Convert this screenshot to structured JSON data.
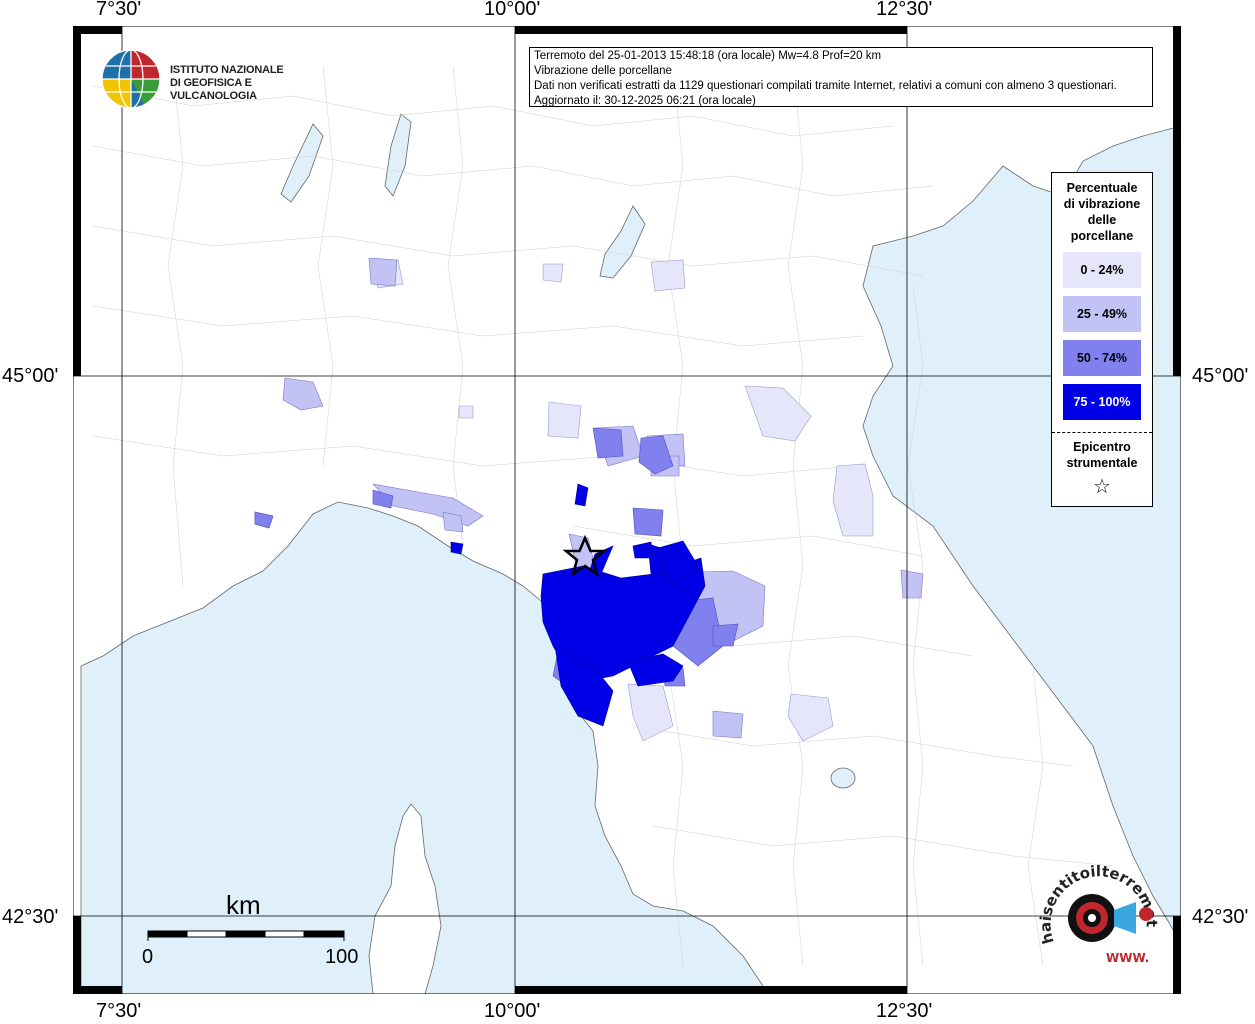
{
  "coords": {
    "lon_labels": [
      "7°30'",
      "10°00'",
      "12°30'"
    ],
    "lat_labels": [
      "45°00'",
      "42°30'"
    ]
  },
  "info": {
    "line1": "Terremoto del 25-01-2013 15:48:18 (ora locale) Mw=4.8 Prof=20 km",
    "line2": "Vibrazione delle porcellane",
    "line3": "Dati non verificati estratti da 1129 questionari compilati tramite Internet, relativi a comuni con almeno 3 questionari.",
    "line4": "Aggiornato il: 30-12-2025 06:21 (ora locale)"
  },
  "logo": {
    "line1": "ISTITUTO NAZIONALE",
    "line2": "DI GEOFISICA E VULCANOLOGIA"
  },
  "legend": {
    "title": [
      "Percentuale",
      "di vibrazione",
      "delle",
      "porcellane"
    ],
    "items": [
      {
        "label": "0 - 24%",
        "color": "#e6e6fa"
      },
      {
        "label": "25 - 49%",
        "color": "#c2c2f4"
      },
      {
        "label": "50 - 74%",
        "color": "#8080ef"
      },
      {
        "label": "75 - 100%",
        "color": "#0000e6"
      }
    ],
    "epicenter": [
      "Epicentro",
      "strumentale"
    ],
    "epicenter_symbol": "☆"
  },
  "scale": {
    "unit": "km",
    "min": "0",
    "max": "100"
  },
  "haisentito": {
    "text": "haisentitoilterremoto.it",
    "www": "WWW."
  },
  "colors": {
    "sea": "#dff0fb",
    "land": "#ffffff"
  }
}
